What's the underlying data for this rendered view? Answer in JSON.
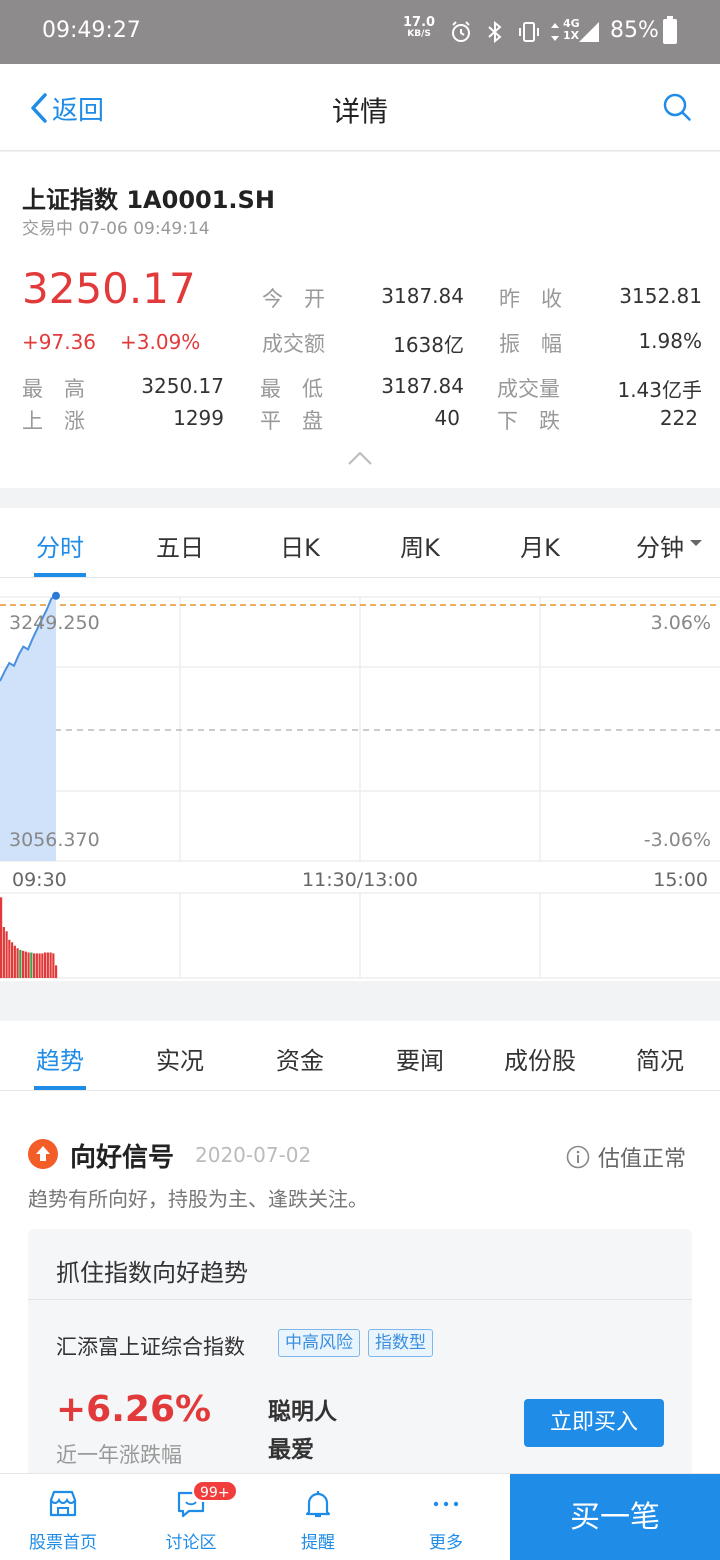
{
  "status_bar": {
    "time": "09:49:27",
    "speed_value": "17.0",
    "speed_unit": "KB/S",
    "network": "4G",
    "network_sub": "1X",
    "battery": "85%"
  },
  "nav": {
    "back_label": "返回",
    "title": "详情"
  },
  "quote": {
    "name": "上证指数 1A0001.SH",
    "status": "交易中 07-06 09:49:14",
    "price": "3250.17",
    "change": "+97.36",
    "change_pct": "+3.09%",
    "fields": {
      "open_label": "今　开",
      "open": "3187.84",
      "prev_close_label": "昨　收",
      "prev_close": "3152.81",
      "amount_label": "成交额",
      "amount": "1638亿",
      "amplitude_label": "振　幅",
      "amplitude": "1.98%",
      "high_label": "最　高",
      "high": "3250.17",
      "low_label": "最　低",
      "low": "3187.84",
      "volume_label": "成交量",
      "volume": "1.43亿手",
      "up_label": "上　涨",
      "up": "1299",
      "flat_label": "平　盘",
      "flat": "40",
      "down_label": "下　跌",
      "down": "222"
    }
  },
  "chart_tabs": [
    "分时",
    "五日",
    "日K",
    "周K",
    "月K",
    "分钟"
  ],
  "chart_data": {
    "type": "line",
    "y_top": "3249.250",
    "y_bottom": "3056.370",
    "pct_top": "3.06%",
    "pct_bottom": "-3.06%",
    "x_labels": [
      "09:30",
      "11:30/13:00",
      "15:00"
    ],
    "ylim": [
      3056.37,
      3249.25
    ],
    "prev_close": 3152.81,
    "series": [
      {
        "values": [
          3187.84,
          3195,
          3201,
          3199,
          3207,
          3213,
          3211,
          3219,
          3226,
          3233,
          3240,
          3248,
          3250.17
        ]
      }
    ],
    "volume": [
      0.95,
      0.6,
      0.55,
      0.45,
      0.42,
      0.38,
      0.35,
      0.33,
      0.32,
      0.31,
      0.3,
      0.3,
      0.29,
      0.29,
      0.29,
      0.29,
      0.3,
      0.3,
      0.3,
      0.29,
      0.15
    ]
  },
  "section_tabs": [
    "趋势",
    "实况",
    "资金",
    "要闻",
    "成份股",
    "简况"
  ],
  "trend": {
    "signal": "向好信号",
    "date": "2020-07-02",
    "valuation": "估值正常",
    "desc": "趋势有所向好，持股为主、逢跌关注。",
    "card_title": "抓住指数向好趋势",
    "fund_name": "汇添富上证综合指数",
    "tag1": "中高风险",
    "tag2": "指数型",
    "fund_pct": "+6.26%",
    "fund_pct_label": "近一年涨跌幅",
    "slogan_line1": "聪明人",
    "slogan_line2": "最爱",
    "buy_now": "立即买入"
  },
  "bottom_nav": {
    "home": "股票首页",
    "discuss": "讨论区",
    "discuss_badge": "99+",
    "remind": "提醒",
    "more": "更多",
    "buy_one": "买一笔"
  },
  "colors": {
    "accent": "#1f8ce8",
    "up": "#e23a3a",
    "signal": "#f25d28"
  }
}
